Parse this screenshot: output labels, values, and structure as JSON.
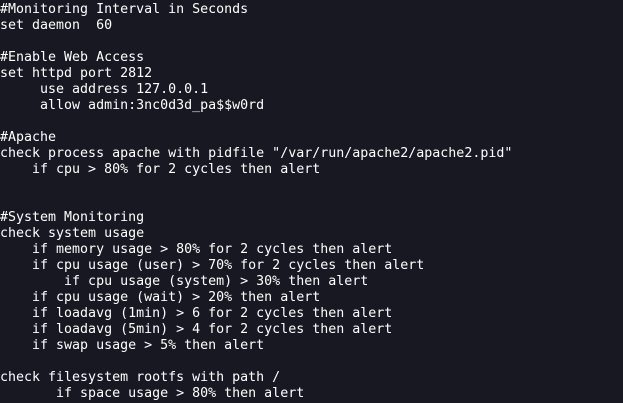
{
  "terminal": {
    "lines": [
      "#Monitoring Interval in Seconds",
      "set daemon  60",
      "",
      "#Enable Web Access",
      "set httpd port 2812",
      "     use address 127.0.0.1",
      "     allow admin:3nc0d3d_pa$$w0rd",
      "",
      "#Apache",
      "check process apache with pidfile \"/var/run/apache2/apache2.pid\"",
      "    if cpu > 80% for 2 cycles then alert",
      "",
      "",
      "#System Monitoring",
      "check system usage",
      "    if memory usage > 80% for 2 cycles then alert",
      "    if cpu usage (user) > 70% for 2 cycles then alert",
      "        if cpu usage (system) > 30% then alert",
      "    if cpu usage (wait) > 20% then alert",
      "    if loadavg (1min) > 6 for 2 cycles then alert",
      "    if loadavg (5min) > 4 for 2 cycles then alert",
      "    if swap usage > 5% then alert",
      "",
      "check filesystem rootfs with path /",
      "       if space usage > 80% then alert"
    ]
  }
}
